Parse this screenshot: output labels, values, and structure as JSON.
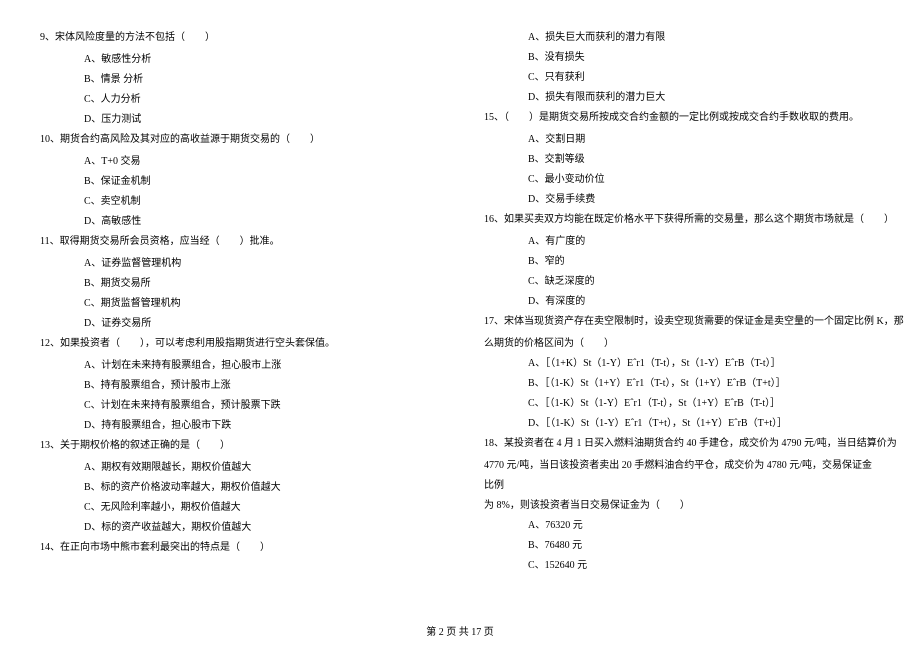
{
  "left_column": {
    "items": [
      {
        "type": "q",
        "text": "9、宋体风险度量的方法不包括（　　）"
      },
      {
        "type": "o",
        "text": "A、敏感性分析"
      },
      {
        "type": "o",
        "text": "B、情景 分析"
      },
      {
        "type": "o",
        "text": "C、人力分析"
      },
      {
        "type": "o",
        "text": "D、压力测试"
      },
      {
        "type": "q",
        "text": "10、期货合约高风险及其对应的高收益源于期货交易的（　　）"
      },
      {
        "type": "o",
        "text": "A、T+0 交易"
      },
      {
        "type": "o",
        "text": "B、保证金机制"
      },
      {
        "type": "o",
        "text": "C、卖空机制"
      },
      {
        "type": "o",
        "text": "D、高敏感性"
      },
      {
        "type": "q",
        "text": "11、取得期货交易所会员资格，应当经（　　）批准。"
      },
      {
        "type": "o",
        "text": "A、证券监督管理机构"
      },
      {
        "type": "o",
        "text": "B、期货交易所"
      },
      {
        "type": "o",
        "text": "C、期货监督管理机构"
      },
      {
        "type": "o",
        "text": "D、证券交易所"
      },
      {
        "type": "q",
        "text": "12、如果投资者（　　），可以考虑利用股指期货进行空头套保值。"
      },
      {
        "type": "o",
        "text": "A、计划在未来持有股票组合，担心股市上涨"
      },
      {
        "type": "o",
        "text": "B、持有股票组合，预计股市上涨"
      },
      {
        "type": "o",
        "text": "C、计划在未来持有股票组合，预计股票下跌"
      },
      {
        "type": "o",
        "text": "D、持有股票组合，担心股市下跌"
      },
      {
        "type": "q",
        "text": "13、关于期权价格的叙述正确的是（　　）"
      },
      {
        "type": "o",
        "text": "A、期权有效期限越长，期权价值越大"
      },
      {
        "type": "o",
        "text": "B、标的资产价格波动率越大，期权价值越大"
      },
      {
        "type": "o",
        "text": "C、无风险利率越小，期权价值越大"
      },
      {
        "type": "o",
        "text": "D、标的资产收益越大，期权价值越大"
      },
      {
        "type": "q",
        "text": "14、在正向市场中熊市套利最突出的特点是（　　）"
      }
    ]
  },
  "right_column": {
    "items": [
      {
        "type": "o",
        "text": "A、损失巨大而获利的潜力有限"
      },
      {
        "type": "o",
        "text": "B、没有损失"
      },
      {
        "type": "o",
        "text": "C、只有获利"
      },
      {
        "type": "o",
        "text": "D、损失有限而获利的潜力巨大"
      },
      {
        "type": "q",
        "text": "15、（　　）是期货交易所按成交合约金额的一定比例或按成交合约手数收取的费用。"
      },
      {
        "type": "o",
        "text": "A、交割日期"
      },
      {
        "type": "o",
        "text": "B、交割等级"
      },
      {
        "type": "o",
        "text": "C、最小变动价位"
      },
      {
        "type": "o",
        "text": "D、交易手续费"
      },
      {
        "type": "q",
        "text": "16、如果买卖双方均能在既定价格水平下获得所需的交易量，那么这个期货市场就是（　　）"
      },
      {
        "type": "o",
        "text": "A、有广度的"
      },
      {
        "type": "o",
        "text": "B、窄的"
      },
      {
        "type": "o",
        "text": "C、缺乏深度的"
      },
      {
        "type": "o",
        "text": "D、有深度的"
      },
      {
        "type": "q",
        "text": "17、宋体当现货资产存在卖空限制时，设卖空现货需要的保证金是卖空量的一个固定比例 K，那"
      },
      {
        "type": "c",
        "text": "么期货的价格区间为（　　）"
      },
      {
        "type": "o",
        "text": "A、［（1+K）St（1-Y）Eˆr1（T-t），St（1-Y）EˆrB（T-t）］"
      },
      {
        "type": "o",
        "text": "B、［（1-K）St（1+Y）Eˆr1（T-t），St（1+Y）EˆrB（T+t）］"
      },
      {
        "type": "o",
        "text": "C、［（1-K）St（1-Y）Eˆr1（T-t），St（1+Y）EˆrB（T-t）］"
      },
      {
        "type": "o",
        "text": "D、［（1-K）St（1-Y）Eˆr1（T+t），St（1+Y）EˆrB（T+t）］"
      },
      {
        "type": "q",
        "text": "18、某投资者在 4 月 1 日买入燃料油期货合约 40 手建仓，成交价为 4790 元/吨，当日结算价为"
      },
      {
        "type": "c",
        "text": "4770 元/吨，当日该投资者卖出 20 手燃料油合约平仓，成交价为 4780 元/吨，交易保证金比例"
      },
      {
        "type": "c",
        "text": "为 8%，则该投资者当日交易保证金为（　　）"
      },
      {
        "type": "o",
        "text": "A、76320 元"
      },
      {
        "type": "o",
        "text": "B、76480 元"
      },
      {
        "type": "o",
        "text": "C、152640 元"
      }
    ]
  },
  "footer": "第 2 页 共 17 页"
}
